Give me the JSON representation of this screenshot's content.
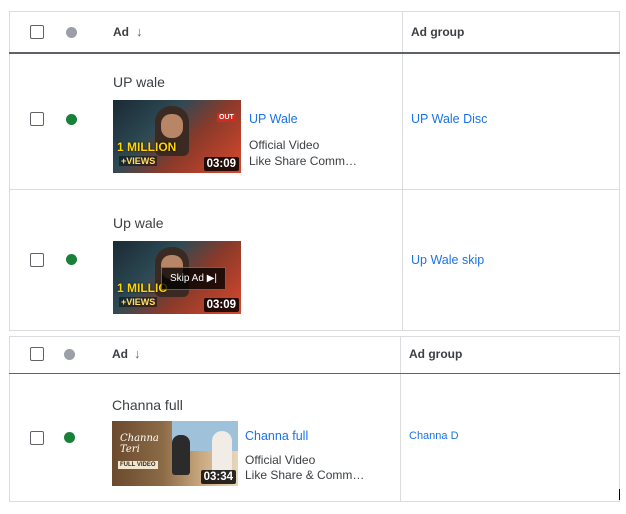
{
  "table1": {
    "header": {
      "ad_label": "Ad",
      "adgroup_label": "Ad group",
      "sort_arrow": "↓"
    },
    "rows": [
      {
        "name": "UP wale",
        "title": "UP Wale",
        "line1": "Official Video",
        "line2": "Like Share Comm…",
        "duration": "03:09",
        "badge": "1 MILLION",
        "views": "+VIEWS",
        "out": "OUT",
        "ad_group": "UP Wale Disc",
        "status": "enabled"
      },
      {
        "name": "Up wale",
        "skip": "Skip Ad ▶|",
        "duration": "03:09",
        "badge": "1 MILLIO",
        "views": "+VIEWS",
        "ad_group": "Up Wale skip",
        "status": "enabled"
      }
    ]
  },
  "table2": {
    "header": {
      "ad_label": "Ad",
      "adgroup_label": "Ad group",
      "sort_arrow": "↓"
    },
    "rows": [
      {
        "name": "Channa full",
        "title": "Channa full",
        "line1": "Official Video",
        "line2": "Like Share & Comm…",
        "duration": "03:34",
        "thumb_title": "Channa Teri",
        "thumb_tag": "FULL VIDEO",
        "ad_group": "Channa D",
        "status": "enabled"
      }
    ]
  },
  "colors": {
    "link": "#1a73e8",
    "enabled": "#188038",
    "status_header": "#9aa0a6",
    "border": "#dadce0"
  }
}
